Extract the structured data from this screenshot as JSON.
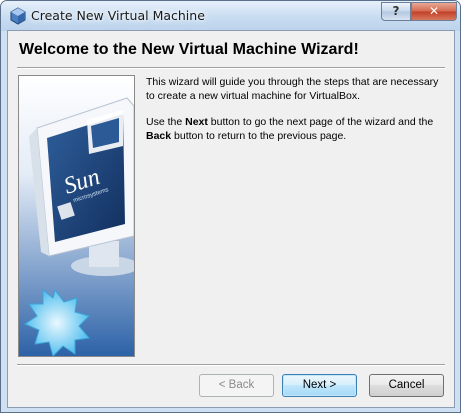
{
  "window": {
    "title": "Create New Virtual Machine",
    "help_label": "?",
    "close_label": "✕"
  },
  "wizard": {
    "heading": "Welcome to the New Virtual Machine Wizard!",
    "para1": "This wizard will guide you through the steps that are necessary to create a new virtual machine for VirtualBox.",
    "para2_pre": "Use the ",
    "para2_next": "Next",
    "para2_mid": " button to go the next page of the wizard and the ",
    "para2_back": "Back",
    "para2_post": " button to return to the previous page."
  },
  "banner": {
    "logo_text": "Sun",
    "logo_subtext": "microsystems"
  },
  "buttons": {
    "back": "< Back",
    "next": "Next >",
    "cancel": "Cancel"
  },
  "colors": {
    "title_bg": "#c8dcf1",
    "accent_blue": "#1c4f93",
    "close_red": "#c2402a"
  }
}
